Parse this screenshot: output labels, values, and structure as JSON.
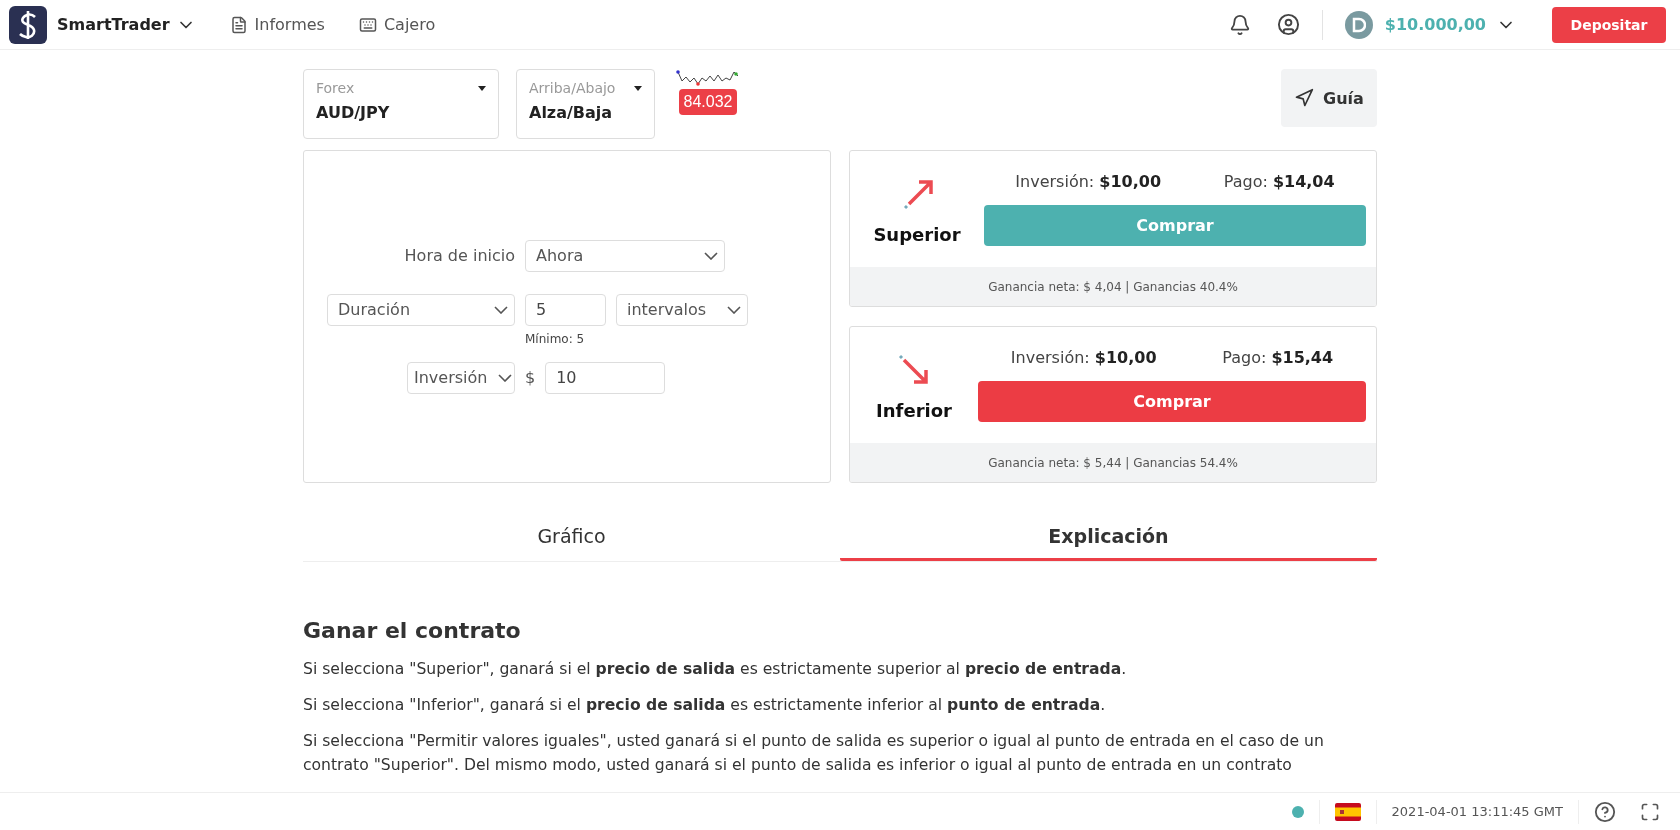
{
  "header": {
    "brand": "SmartTrader",
    "nav": [
      {
        "kind": "reports",
        "label": "Informes"
      },
      {
        "kind": "cashier",
        "label": "Cajero"
      }
    ],
    "balance": "$10.000,00",
    "deposit_button": "Depositar"
  },
  "market": {
    "category": {
      "label": "Forex",
      "value": "AUD/JPY"
    },
    "trade_type": {
      "label": "Arriba/Abajo",
      "value": "Alza/Baja"
    },
    "price": "84.032",
    "guide_button": "Guía"
  },
  "form": {
    "start_label": "Hora de inicio",
    "start_value": "Ahora",
    "duration_type": "Duración",
    "duration_value": "5",
    "duration_unit": "intervalos",
    "minimum_hint": "Mínimo: 5",
    "amount_type": "Inversión",
    "currency": "$",
    "amount_value": "10"
  },
  "contracts": [
    {
      "kind": "up",
      "label": "Superior",
      "investment": "Inversión: **$10,00**",
      "payout": "Pago: **$14,04**",
      "button": "Comprar",
      "summary": "Ganancia neta: $ 4,04 | Ganancias 40.4%"
    },
    {
      "kind": "down",
      "label": "Inferior",
      "investment": "Inversión: **$10,00**",
      "payout": "Pago: **$15,44**",
      "button": "Comprar",
      "summary": "Ganancia neta: $ 5,44 | Ganancias 54.4%"
    }
  ],
  "tabs": [
    {
      "label": "Gráfico",
      "selected": false
    },
    {
      "label": "Explicación",
      "selected": true
    }
  ],
  "explanation": {
    "title": "Ganar el contrato",
    "paragraphs": [
      "Si selecciona \"Superior\", ganará si el **precio de salida** es estrictamente superior al **precio de entrada**.",
      "Si selecciona \"Inferior\", ganará si el **precio de salida** es estrictamente inferior al **punto de entrada**.",
      "Si selecciona \"Permitir valores iguales\", usted ganará si el punto de salida es superior o igual al punto de entrada en el caso de un contrato \"Superior\". Del mismo modo, usted ganará si el punto de salida es inferior o igual al punto de entrada en un contrato"
    ]
  },
  "footer": {
    "time": "2021-04-01 13:11:45 GMT"
  }
}
